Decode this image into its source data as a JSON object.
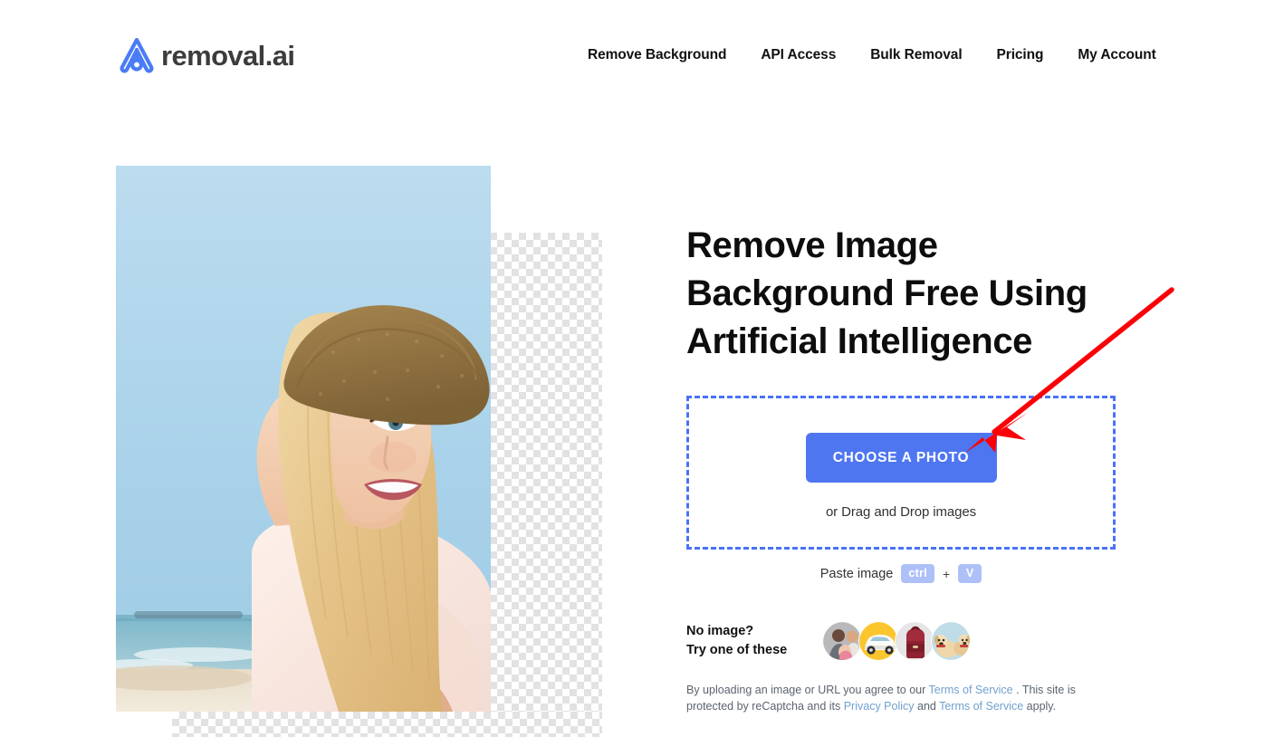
{
  "header": {
    "logo": {
      "icon": "removal-ai-logo-icon",
      "text": "removal.ai"
    },
    "nav": [
      {
        "label": "Remove Background"
      },
      {
        "label": "API Access"
      },
      {
        "label": "Bulk Removal"
      },
      {
        "label": "Pricing"
      },
      {
        "label": "My Account"
      }
    ]
  },
  "hero": {
    "headline": "Remove Image Background Free Using Artificial Intelligence",
    "dropzone": {
      "button_label": "CHOOSE A PHOTO",
      "drag_text": "or Drag and Drop images"
    },
    "paste": {
      "label": "Paste image",
      "key1": "ctrl",
      "separator": "+",
      "key2": "V"
    },
    "samples": {
      "line1": "No image?",
      "line2": "Try one of these",
      "items": [
        {
          "name": "sample-thumbnail-family"
        },
        {
          "name": "sample-thumbnail-car"
        },
        {
          "name": "sample-thumbnail-backpack"
        },
        {
          "name": "sample-thumbnail-dog"
        }
      ]
    },
    "legal": {
      "part1": "By uploading an image or URL you agree to our ",
      "link1": "Terms of Service",
      "part2": " . This site is protected by reCaptcha and its ",
      "link2": "Privacy Policy",
      "part3": " and ",
      "link3": "Terms of Service",
      "part4": " apply."
    }
  },
  "preview": {
    "alt": "Woman in straw hat at the beach with background removed"
  },
  "annotation": {
    "type": "red-arrow",
    "points_to": "CHOOSE A PHOTO",
    "color": "#fb0007"
  },
  "colors": {
    "accent_blue": "#4f76f1",
    "dashed_border": "#4a72f5",
    "key_badge": "#aec0f8",
    "link_blue": "#72a0cf",
    "logo_blue": "#4a7cf5",
    "heading": "#0d0d0d",
    "annotation_red": "#fb0007"
  }
}
